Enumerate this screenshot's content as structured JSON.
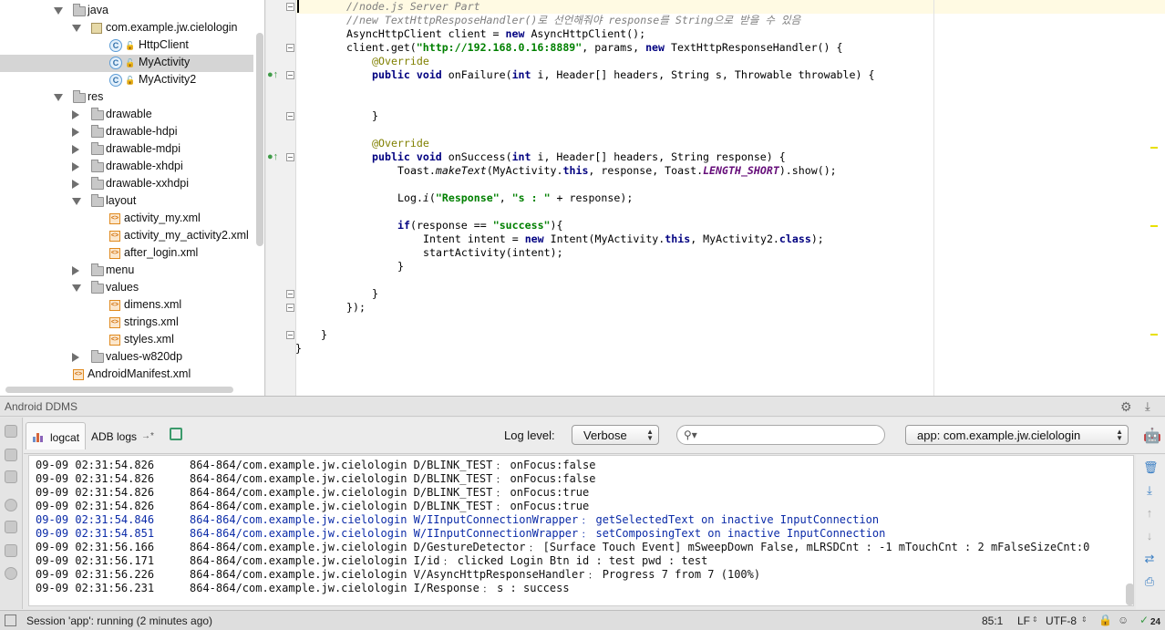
{
  "tree": {
    "rows": [
      {
        "label": "java",
        "kind": "folder",
        "arrow": "open"
      },
      {
        "label": "com.example.jw.cielologin",
        "kind": "package",
        "arrow": "open"
      },
      {
        "label": "HttpClient",
        "kind": "class",
        "arrow": "none"
      },
      {
        "label": "MyActivity",
        "kind": "class",
        "arrow": "none",
        "selected": true
      },
      {
        "label": "MyActivity2",
        "kind": "class",
        "arrow": "none"
      },
      {
        "label": "res",
        "kind": "folder",
        "arrow": "open"
      },
      {
        "label": "drawable",
        "kind": "folder",
        "arrow": "closed"
      },
      {
        "label": "drawable-hdpi",
        "kind": "folder",
        "arrow": "closed"
      },
      {
        "label": "drawable-mdpi",
        "kind": "folder",
        "arrow": "closed"
      },
      {
        "label": "drawable-xhdpi",
        "kind": "folder",
        "arrow": "closed"
      },
      {
        "label": "drawable-xxhdpi",
        "kind": "folder",
        "arrow": "closed"
      },
      {
        "label": "layout",
        "kind": "folder",
        "arrow": "open"
      },
      {
        "label": "activity_my.xml",
        "kind": "xml",
        "arrow": "none"
      },
      {
        "label": "activity_my_activity2.xml",
        "kind": "xml",
        "arrow": "none"
      },
      {
        "label": "after_login.xml",
        "kind": "xml",
        "arrow": "none"
      },
      {
        "label": "menu",
        "kind": "folder",
        "arrow": "closed"
      },
      {
        "label": "values",
        "kind": "folder",
        "arrow": "open"
      },
      {
        "label": "dimens.xml",
        "kind": "xml",
        "arrow": "none"
      },
      {
        "label": "strings.xml",
        "kind": "xml",
        "arrow": "none"
      },
      {
        "label": "styles.xml",
        "kind": "xml",
        "arrow": "none"
      },
      {
        "label": "values-w820dp",
        "kind": "folder",
        "arrow": "closed"
      },
      {
        "label": "AndroidManifest.xml",
        "kind": "xml",
        "arrow": "none"
      }
    ]
  },
  "editor": {
    "lines": {
      "l0": "//node.js Server Part",
      "l1": "//new TextHttpResposeHandler()로 선언해줘야 response를 String으로 받을 수 있음",
      "l2_type": "AsyncHttpClient client = ",
      "l2_new": "new",
      "l2_rest": " AsyncHttpClient();",
      "l3_a": "client.get(",
      "l3_url": "\"http://192.168.0.16:8889\"",
      "l3_b": ", params, ",
      "l3_new": "new",
      "l3_c": " TextHttpResponseHandler() {",
      "l4": "@Override",
      "l5_pub": "public void",
      "l5_a": " onFailure(",
      "l5_int": "int",
      "l5_b": " i, Header[] headers, String s, Throwable throwable) {",
      "l8": "}",
      "l10": "@Override",
      "l11_pub": "public void",
      "l11_a": " onSuccess(",
      "l11_int": "int",
      "l11_b": " i, Header[] headers, String response) {",
      "l12_a": "Toast.",
      "l12_m": "makeText",
      "l12_b": "(MyActivity.",
      "l12_this": "this",
      "l12_c": ", response, Toast.",
      "l12_const": "LENGTH_SHORT",
      "l12_d": ").show();",
      "l14_a": "Log.",
      "l14_m": "i",
      "l14_b": "(",
      "l14_s1": "\"Response\"",
      "l14_c": ", ",
      "l14_s2": "\"s : \"",
      "l14_d": " + response);",
      "l16_if": "if",
      "l16_a": "(response == ",
      "l16_s": "\"success\"",
      "l16_b": "){",
      "l17_a": "Intent intent = ",
      "l17_new": "new",
      "l17_b": " Intent(MyActivity.",
      "l17_this": "this",
      "l17_c": ", MyActivity2.",
      "l17_cls": "class",
      "l17_d": ");",
      "l18": "startActivity(intent);",
      "l19": "}",
      "l21": "}",
      "l22": "});",
      "l24": "}",
      "l25": "}"
    }
  },
  "ddms": {
    "title": "Android DDMS",
    "tabs": {
      "logcat": "logcat",
      "adb": "ADB logs",
      "adb_arrow": "→*"
    },
    "log_level_label": "Log level:",
    "log_level_value": "Verbose",
    "search_value": "",
    "app_value": "app: com.example.jw.cielologin"
  },
  "log": {
    "rows": [
      {
        "ts": "09-09 02:31:54.826",
        "msg": "864-864/com.example.jw.cielologin D/BLINK_TEST﹕ onFocus:false",
        "level": "D"
      },
      {
        "ts": "09-09 02:31:54.826",
        "msg": "864-864/com.example.jw.cielologin D/BLINK_TEST﹕ onFocus:false",
        "level": "D"
      },
      {
        "ts": "09-09 02:31:54.826",
        "msg": "864-864/com.example.jw.cielologin D/BLINK_TEST﹕ onFocus:true",
        "level": "D"
      },
      {
        "ts": "09-09 02:31:54.826",
        "msg": "864-864/com.example.jw.cielologin D/BLINK_TEST﹕ onFocus:true",
        "level": "D"
      },
      {
        "ts": "09-09 02:31:54.846",
        "msg": "864-864/com.example.jw.cielologin W/IInputConnectionWrapper﹕ getSelectedText on inactive InputConnection",
        "level": "W"
      },
      {
        "ts": "09-09 02:31:54.851",
        "msg": "864-864/com.example.jw.cielologin W/IInputConnectionWrapper﹕ setComposingText on inactive InputConnection",
        "level": "W"
      },
      {
        "ts": "09-09 02:31:56.166",
        "msg": "864-864/com.example.jw.cielologin D/GestureDetector﹕ [Surface Touch Event] mSweepDown False, mLRSDCnt : -1 mTouchCnt : 2 mFalseSizeCnt:0",
        "level": "D"
      },
      {
        "ts": "09-09 02:31:56.171",
        "msg": "864-864/com.example.jw.cielologin I/id﹕ clicked Login Btn id : test pwd : test",
        "level": "I"
      },
      {
        "ts": "09-09 02:31:56.226",
        "msg": "864-864/com.example.jw.cielologin V/AsyncHttpResponseHandler﹕ Progress 7 from 7 (100%)",
        "level": "V"
      },
      {
        "ts": "09-09 02:31:56.231",
        "msg": "864-864/com.example.jw.cielologin I/Response﹕ s : success",
        "level": "I"
      }
    ]
  },
  "status": {
    "message": "Session 'app': running (2 minutes ago)",
    "position": "85:1",
    "line_sep": "LF",
    "encoding": "UTF-8",
    "badge": "24"
  },
  "colors": {
    "warn_log": "#0b2ba8",
    "keyword": "#000080",
    "string": "#008000",
    "comment": "#808080",
    "annotation": "#808000",
    "selected_row": "#d5d5d5"
  }
}
